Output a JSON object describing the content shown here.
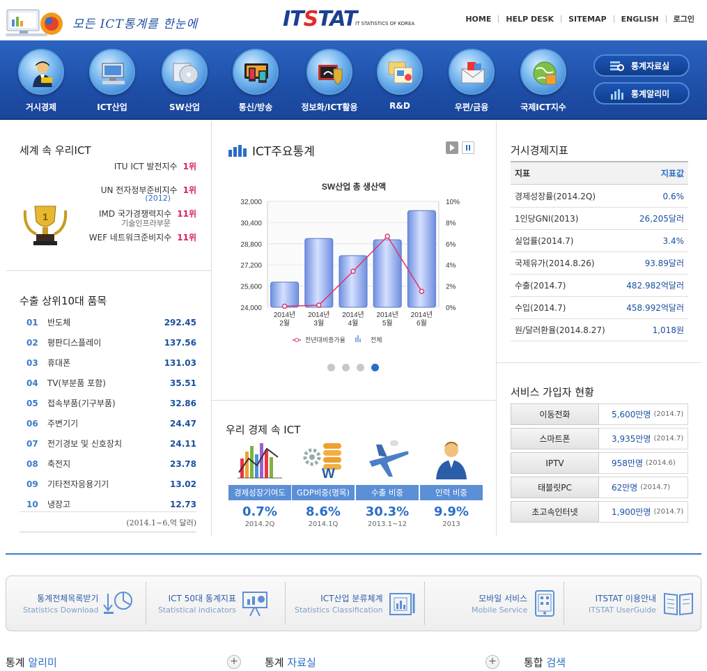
{
  "header": {
    "slogan": "모든 ICT통계를 한눈에",
    "brand_it": "IT",
    "brand_s": "S",
    "brand_tat": "TAT",
    "brand_sub": "IT STATISTICS OF KOREA",
    "nav": [
      "HOME",
      "HELP DESK",
      "SITEMAP",
      "ENGLISH",
      "로그인"
    ]
  },
  "categories": [
    {
      "label": "거시경제",
      "icon": "businessman-icon"
    },
    {
      "label": "ICT산업",
      "icon": "computer-icon"
    },
    {
      "label": "SW산업",
      "icon": "software-disc-icon"
    },
    {
      "label": "통신/방송",
      "icon": "devices-icon"
    },
    {
      "label": "정보화/ICT활용",
      "icon": "security-shield-icon"
    },
    {
      "label": "R&D",
      "icon": "folders-icon"
    },
    {
      "label": "우편/금융",
      "icon": "mail-icon"
    },
    {
      "label": "국제ICT지수",
      "icon": "globe-icon"
    }
  ],
  "band_buttons": [
    {
      "label": "통계자료실",
      "icon": "data-room-icon"
    },
    {
      "label": "통계알리미",
      "icon": "bar-chart-icon"
    }
  ],
  "world_ict": {
    "title": "세계 속 우리ICT",
    "items": [
      {
        "name": "ITU ICT 발전지수",
        "rank": "1위"
      },
      {
        "name": "UN 전자정부준비지수",
        "rank": "1위",
        "sub": "(2012)"
      },
      {
        "name": "IMD 국가경쟁력지수",
        "rank": "11위",
        "sub": "기술인프라부문"
      },
      {
        "name": "WEF 네트워크준비지수",
        "rank": "11위"
      }
    ]
  },
  "export_top10": {
    "title": "수출 상위10대 품목",
    "items": [
      {
        "no": "01",
        "name": "반도체",
        "value": "292.45"
      },
      {
        "no": "02",
        "name": "평판디스플레이",
        "value": "137.56"
      },
      {
        "no": "03",
        "name": "휴대폰",
        "value": "131.03"
      },
      {
        "no": "04",
        "name": "TV(부분품 포함)",
        "value": "35.51"
      },
      {
        "no": "05",
        "name": "접속부품(기구부품)",
        "value": "32.86"
      },
      {
        "no": "06",
        "name": "주변기기",
        "value": "24.47"
      },
      {
        "no": "07",
        "name": "전기경보 및 신호장치",
        "value": "24.11"
      },
      {
        "no": "08",
        "name": "축전지",
        "value": "23.78"
      },
      {
        "no": "09",
        "name": "기타전자응용기기",
        "value": "13.02"
      },
      {
        "no": "10",
        "name": "냉장고",
        "value": "12.73"
      }
    ],
    "note": "(2014.1~6,억 달러)"
  },
  "ict_stats": {
    "title": "ICT주요통계"
  },
  "chart_data": {
    "type": "bar",
    "title": "SW산업 총 생산액",
    "categories": [
      "2014년 2월",
      "2014년 3월",
      "2014년 4월",
      "2014년 5월",
      "2014년 6월"
    ],
    "cat_line1": [
      "2014년",
      "2014년",
      "2014년",
      "2014년",
      "2014년"
    ],
    "cat_line2": [
      "2월",
      "3월",
      "4월",
      "5월",
      "6월"
    ],
    "series": [
      {
        "name": "전체",
        "type": "bar",
        "axis": "left",
        "values": [
          25900,
          29200,
          27900,
          29100,
          31300
        ]
      },
      {
        "name": "전년대비증가율",
        "type": "line",
        "axis": "right",
        "values": [
          0.1,
          0.2,
          3.4,
          6.7,
          1.5
        ]
      }
    ],
    "ylim": [
      24000,
      32000
    ],
    "yticks": [
      "32,000",
      "30,400",
      "28,800",
      "27,200",
      "25,600",
      "24,000"
    ],
    "y2lim": [
      0,
      10
    ],
    "y2ticks": [
      "10%",
      "8%",
      "6%",
      "4%",
      "2%",
      "0%"
    ],
    "legend_position": "bottom",
    "colors": {
      "bar": "#8aa8ec",
      "line": "#d8366b"
    }
  },
  "macro": {
    "title": "거시경제지표",
    "head": {
      "k": "지표",
      "v": "지표값"
    },
    "rows": [
      {
        "k": "경제성장률(2014.2Q)",
        "v": "0.6%"
      },
      {
        "k": "1인당GNI(2013)",
        "v": "26,205달러"
      },
      {
        "k": "실업률(2014.7)",
        "v": "3.4%"
      },
      {
        "k": "국제유가(2014.8.26)",
        "v": "93.89달러"
      },
      {
        "k": "수출(2014.7)",
        "v": "482.982억달러"
      },
      {
        "k": "수입(2014.7)",
        "v": "458.992억달러"
      },
      {
        "k": "원/달러환율(2014.8.27)",
        "v": "1,018원"
      }
    ]
  },
  "services": {
    "title": "서비스 가입자 현황",
    "rows": [
      {
        "k": "이동전화",
        "v": "5,600만명",
        "d": "(2014.7)"
      },
      {
        "k": "스마트폰",
        "v": "3,935만명",
        "d": "(2014.7)"
      },
      {
        "k": "IPTV",
        "v": "958만명",
        "d": "(2014.6)"
      },
      {
        "k": "태블릿PC",
        "v": "62만명",
        "d": "(2014.7)"
      },
      {
        "k": "초고속인터넷",
        "v": "1,900만명",
        "d": "(2014.7)"
      }
    ]
  },
  "economy_ict": {
    "title": "우리 경제 속 ICT",
    "items": [
      {
        "tag": "경제성장기여도",
        "val": "0.7%",
        "per": "2014.2Q",
        "icon": "bar-graph-icon"
      },
      {
        "tag": "GDP비중(명목)",
        "val": "8.6%",
        "per": "2014.1Q",
        "icon": "gear-coins-icon"
      },
      {
        "tag": "수출 비중",
        "val": "30.3%",
        "per": "2013.1~12",
        "icon": "airplane-icon"
      },
      {
        "tag": "인력 비중",
        "val": "9.9%",
        "per": "2013",
        "icon": "worker-icon"
      }
    ]
  },
  "bottom_links": [
    {
      "main": "통계전체목록받기",
      "sub": "Statistics Download",
      "icon": "download-chart-icon"
    },
    {
      "main": "ICT 50대 통계지표",
      "sub": "Statistical indicators",
      "icon": "presentation-icon"
    },
    {
      "main": "ICT산업 분류체계",
      "sub": "Statistics Classification",
      "icon": "classification-icon"
    },
    {
      "main": "모바일 서비스",
      "sub": "Mobile Service",
      "icon": "mobile-icon"
    },
    {
      "main": "ITSTAT 이용안내",
      "sub": "ITSTAT UserGuide",
      "icon": "guide-book-icon"
    }
  ],
  "footer_sections": [
    {
      "a": "통계",
      "b": "알리미"
    },
    {
      "a": "통계",
      "b": "자료실"
    },
    {
      "a": "통합",
      "b": "검색"
    }
  ]
}
